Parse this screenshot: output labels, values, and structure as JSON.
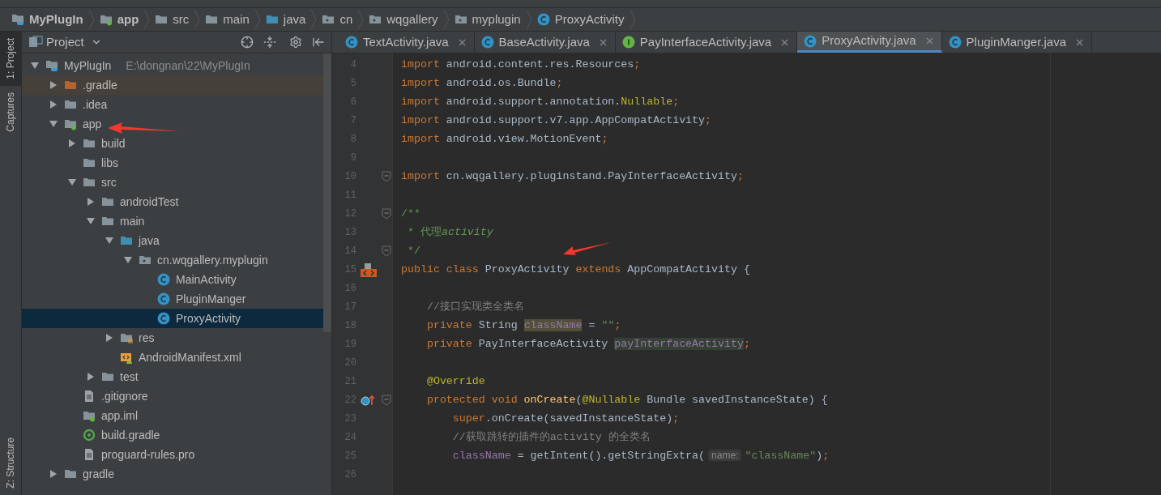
{
  "breadcrumbs": [
    {
      "label": "MyPlugIn",
      "kind": "module",
      "bold": true
    },
    {
      "label": "app",
      "kind": "module-folder",
      "bold": true
    },
    {
      "label": "src",
      "kind": "folder",
      "bold": false
    },
    {
      "label": "main",
      "kind": "folder",
      "bold": false
    },
    {
      "label": "java",
      "kind": "source-folder",
      "bold": false
    },
    {
      "label": "cn",
      "kind": "package",
      "bold": false
    },
    {
      "label": "wqgallery",
      "kind": "package",
      "bold": false
    },
    {
      "label": "myplugin",
      "kind": "package",
      "bold": false
    },
    {
      "label": "ProxyActivity",
      "kind": "class",
      "bold": false
    }
  ],
  "tool_strip": {
    "top": [
      {
        "label": "1: Project",
        "selected": true
      },
      {
        "label": "Captures",
        "selected": false
      }
    ],
    "bottom": [
      {
        "label": "Z: Structure",
        "selected": false
      }
    ]
  },
  "project_panel": {
    "title": "Project"
  },
  "tree": [
    {
      "label": "MyPlugIn",
      "path": "E:\\dongnan\\22\\MyPlugIn",
      "kind": "module",
      "expanded": true,
      "selected": false,
      "children": [
        {
          "label": ".gradle",
          "kind": "folder-excluded",
          "expanded": false,
          "selected": false
        },
        {
          "label": ".idea",
          "kind": "folder",
          "expanded": false,
          "selected": false
        },
        {
          "label": "app",
          "kind": "module-folder",
          "expanded": true,
          "selected": false,
          "children": [
            {
              "label": "build",
              "kind": "folder",
              "expanded": false,
              "selected": false
            },
            {
              "label": "libs",
              "kind": "folder",
              "selected": false
            },
            {
              "label": "src",
              "kind": "folder",
              "expanded": true,
              "selected": false,
              "children": [
                {
                  "label": "androidTest",
                  "kind": "folder",
                  "expanded": false,
                  "selected": false
                },
                {
                  "label": "main",
                  "kind": "folder",
                  "expanded": true,
                  "selected": false,
                  "children": [
                    {
                      "label": "java",
                      "kind": "source-folder",
                      "expanded": true,
                      "selected": false,
                      "children": [
                        {
                          "label": "cn.wqgallery.myplugin",
                          "kind": "package",
                          "expanded": true,
                          "selected": false,
                          "children": [
                            {
                              "label": "MainActivity",
                              "kind": "class",
                              "selected": false
                            },
                            {
                              "label": "PluginManger",
                              "kind": "class",
                              "selected": false
                            },
                            {
                              "label": "ProxyActivity",
                              "kind": "class",
                              "selected": true
                            }
                          ]
                        }
                      ]
                    },
                    {
                      "label": "res",
                      "kind": "resources",
                      "expanded": false,
                      "selected": false
                    },
                    {
                      "label": "AndroidManifest.xml",
                      "kind": "manifest",
                      "selected": false
                    }
                  ]
                },
                {
                  "label": "test",
                  "kind": "folder",
                  "expanded": false,
                  "selected": false
                }
              ]
            },
            {
              "label": ".gitignore",
              "kind": "file",
              "selected": false
            },
            {
              "label": "app.iml",
              "kind": "module-folder",
              "selected": false
            },
            {
              "label": "build.gradle",
              "kind": "gradle",
              "selected": false
            },
            {
              "label": "proguard-rules.pro",
              "kind": "file",
              "selected": false
            }
          ]
        },
        {
          "label": "gradle",
          "kind": "folder",
          "expanded": false,
          "selected": false
        }
      ]
    }
  ],
  "tabs": [
    {
      "label": "TextActivity.java",
      "kind": "class",
      "selected": false
    },
    {
      "label": "BaseActivity.java",
      "kind": "class",
      "selected": false
    },
    {
      "label": "PayInterfaceActivity.java",
      "kind": "interface",
      "selected": false
    },
    {
      "label": "ProxyActivity.java",
      "kind": "class",
      "selected": true
    },
    {
      "label": "PluginManger.java",
      "kind": "class",
      "selected": false
    }
  ],
  "code": [
    {
      "number": "4",
      "tokens": [
        {
          "kind": "keyword",
          "text": "import"
        },
        {
          "kind": "plain",
          "text": " android.content.res.Resources"
        },
        {
          "kind": "keyword",
          "text": ";"
        }
      ]
    },
    {
      "number": "5",
      "tokens": [
        {
          "kind": "keyword",
          "text": "import"
        },
        {
          "kind": "plain",
          "text": " android.os.Bundle"
        },
        {
          "kind": "keyword",
          "text": ";"
        }
      ]
    },
    {
      "number": "6",
      "tokens": [
        {
          "kind": "keyword",
          "text": "import"
        },
        {
          "kind": "plain",
          "text": " android.support.annotation."
        },
        {
          "kind": "annotation",
          "text": "Nullable"
        },
        {
          "kind": "keyword",
          "text": ";"
        }
      ]
    },
    {
      "number": "7",
      "tokens": [
        {
          "kind": "keyword",
          "text": "import"
        },
        {
          "kind": "plain",
          "text": " android.support.v7.app.AppCompatActivity"
        },
        {
          "kind": "keyword",
          "text": ";"
        }
      ]
    },
    {
      "number": "8",
      "tokens": [
        {
          "kind": "keyword",
          "text": "import"
        },
        {
          "kind": "plain",
          "text": " android.view.MotionEvent"
        },
        {
          "kind": "keyword",
          "text": ";"
        }
      ]
    },
    {
      "number": "9"
    },
    {
      "number": "10",
      "fold": true,
      "tokens": [
        {
          "kind": "keyword",
          "text": "import"
        },
        {
          "kind": "plain",
          "text": " cn.wqgallery.pluginstand.PayInterfaceActivity"
        },
        {
          "kind": "keyword",
          "text": ";"
        }
      ]
    },
    {
      "number": "11"
    },
    {
      "number": "12",
      "fold": true,
      "tokens": [
        {
          "kind": "doc",
          "text": "/**"
        }
      ]
    },
    {
      "number": "13",
      "tokens": [
        {
          "kind": "doc",
          "text": " * 代理"
        },
        {
          "kind": "doc-italic",
          "text": "activity"
        }
      ]
    },
    {
      "number": "14",
      "fold": true,
      "tokens": [
        {
          "kind": "doc",
          "text": " */"
        }
      ]
    },
    {
      "number": "15",
      "kind": "implements",
      "tokens": [
        {
          "kind": "keyword",
          "text": "public class"
        },
        {
          "kind": "plain",
          "text": " ProxyActivity "
        },
        {
          "kind": "keyword",
          "text": "extends"
        },
        {
          "kind": "plain",
          "text": " AppCompatActivity {"
        }
      ]
    },
    {
      "number": "16"
    },
    {
      "number": "17",
      "tokens": [
        {
          "kind": "comment",
          "text": "    //接口实现类全类名"
        }
      ]
    },
    {
      "number": "18",
      "tokens": [
        {
          "kind": "keyword",
          "text": "    private"
        },
        {
          "kind": "plain",
          "text": " String "
        },
        {
          "kind": "field-written",
          "text": "className"
        },
        {
          "kind": "plain",
          "text": " = "
        },
        {
          "kind": "string",
          "text": "\"\""
        },
        {
          "kind": "keyword",
          "text": ";"
        }
      ]
    },
    {
      "number": "19",
      "tokens": [
        {
          "kind": "keyword",
          "text": "    private"
        },
        {
          "kind": "plain",
          "text": " PayInterfaceActivity "
        },
        {
          "kind": "field-unused",
          "text": "payInterfaceActivity"
        },
        {
          "kind": "keyword",
          "text": ";"
        }
      ]
    },
    {
      "number": "20"
    },
    {
      "number": "21",
      "tokens": [
        {
          "kind": "annotation",
          "text": "    @Override"
        }
      ]
    },
    {
      "number": "22",
      "fold": true,
      "kind": "override",
      "tokens": [
        {
          "kind": "keyword",
          "text": "    protected void "
        },
        {
          "kind": "method",
          "text": "onCreate"
        },
        {
          "kind": "plain",
          "text": "("
        },
        {
          "kind": "annotation",
          "text": "@Nullable"
        },
        {
          "kind": "plain",
          "text": " Bundle savedInstanceState) {"
        }
      ]
    },
    {
      "number": "23",
      "tokens": [
        {
          "kind": "keyword",
          "text": "        super"
        },
        {
          "kind": "plain",
          "text": ".onCreate(savedInstanceState)"
        },
        {
          "kind": "keyword",
          "text": ";"
        }
      ]
    },
    {
      "number": "24",
      "tokens": [
        {
          "kind": "comment",
          "text": "        //获取跳转的插件的activity 的全类名"
        }
      ]
    },
    {
      "number": "25",
      "tokens": [
        {
          "kind": "field",
          "text": "        className"
        },
        {
          "kind": "plain",
          "text": " = getIntent().getStringExtra("
        },
        {
          "kind": "hint",
          "text": "name:"
        },
        {
          "kind": "string",
          "text": "\"className\""
        },
        {
          "kind": "plain",
          "text": ")"
        },
        {
          "kind": "keyword",
          "text": ";"
        }
      ]
    },
    {
      "number": "26"
    }
  ]
}
